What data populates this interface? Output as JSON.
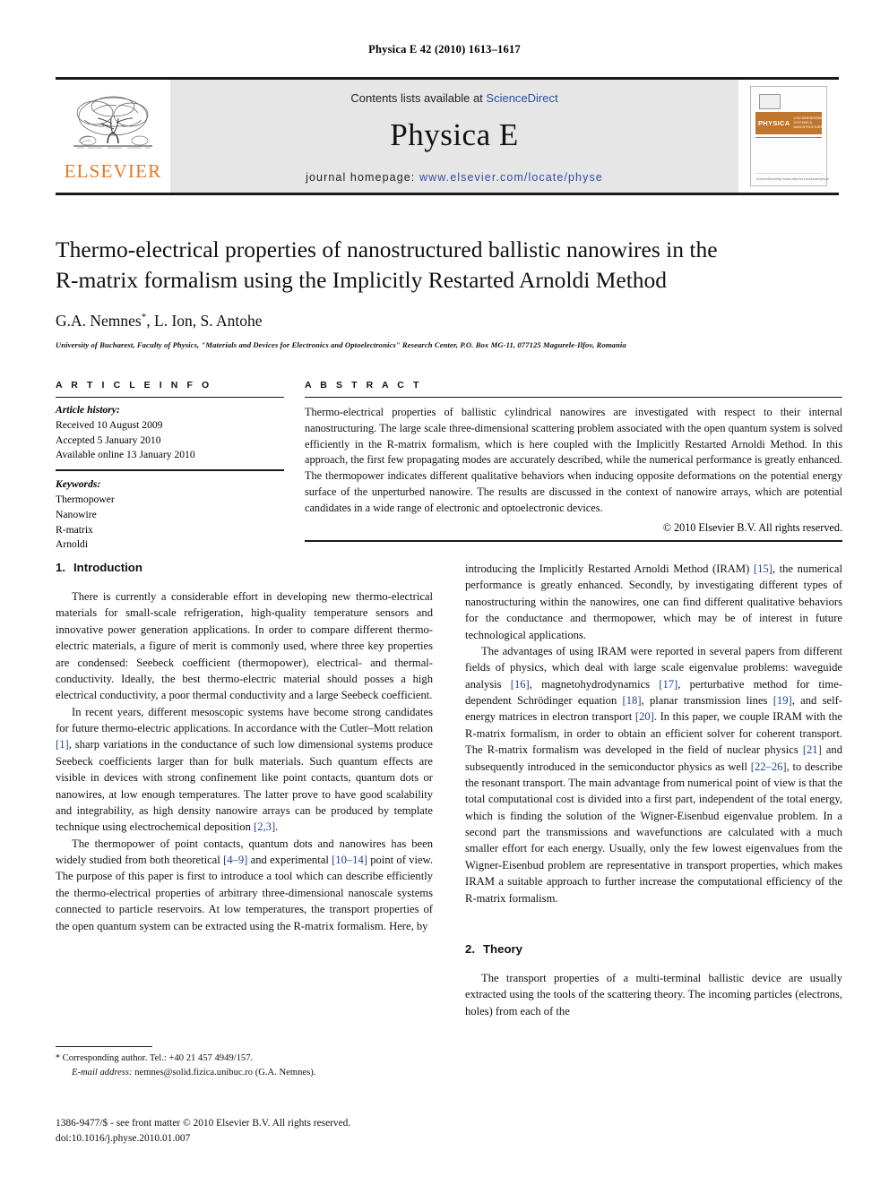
{
  "running_head": "Physica E 42 (2010) 1613–1617",
  "masthead": {
    "contents_prefix": "Contents lists available at ",
    "contents_link": "ScienceDirect",
    "journal_title": "Physica E",
    "homepage_prefix": "journal homepage: ",
    "homepage_url": "www.elsevier.com/locate/physe",
    "publisher_wordmark": "ELSEVIER",
    "publisher_logo_icon": "elsevier-tree-icon",
    "cover": {
      "band_word": "PHYSICA",
      "band_letter": "E",
      "band_subtitle": "LOW-DIMENSIONAL SYSTEMS & NANOSTRUCTURES",
      "footer_left": "Available online at",
      "footer_left_brand": "ScienceDirect",
      "footer_left_url": "www.sciencedirect.com",
      "footer_right": "http://www.elsevier.com/locate/physe"
    },
    "link_color": "#2b4fa2",
    "band_color": "#c0762c",
    "wordmark_color": "#e87722"
  },
  "title_block": {
    "title_line_1": "Thermo-electrical properties of nanostructured ballistic nanowires in the",
    "title_line_2": "R-matrix formalism using the Implicitly Restarted Arnoldi Method",
    "authors": "G.A. Nemnes",
    "authors_marker": "*",
    "authors_rest": ", L. Ion, S. Antohe",
    "affiliation": "University of Bucharest, Faculty of Physics, \"Materials and Devices for Electronics and Optoelectronics\" Research Center, P.O. Box MG-11, 077125 Magurele-Ilfov, Romania"
  },
  "article_info": {
    "heading": "A R T I C L E   I N F O",
    "history_label": "Article history:",
    "history": [
      "Received 10 August 2009",
      "Accepted 5 January 2010",
      "Available online 13 January 2010"
    ],
    "keywords_label": "Keywords:",
    "keywords": [
      "Thermopower",
      "Nanowire",
      "R-matrix",
      "Arnoldi"
    ]
  },
  "abstract": {
    "heading": "A B S T R A C T",
    "text": "Thermo-electrical properties of ballistic cylindrical nanowires are investigated with respect to their internal nanostructuring. The large scale three-dimensional scattering problem associated with the open quantum system is solved efficiently in the R-matrix formalism, which is here coupled with the Implicitly Restarted Arnoldi Method. In this approach, the first few propagating modes are accurately described, while the numerical performance is greatly enhanced. The thermopower indicates different qualitative behaviors when inducing opposite deformations on the potential energy surface of the unperturbed nanowire. The results are discussed in the context of nanowire arrays, which are potential candidates in a wide range of electronic and optoelectronic devices.",
    "copyright": "© 2010 Elsevier B.V. All rights reserved."
  },
  "sections": {
    "introduction": {
      "number": "1.",
      "title": "Introduction",
      "paragraphs_left": [
        "There is currently a considerable effort in developing new thermo-electrical materials for small-scale refrigeration, high-quality temperature sensors and innovative power generation applications. In order to compare different thermo-electric materials, a figure of merit is commonly used, where three key properties are condensed: Seebeck coefficient (thermopower), electrical- and thermal-conductivity. Ideally, the best thermo-electric material should posses a high electrical conductivity, a poor thermal conductivity and a large Seebeck coefficient.",
        "In recent years, different mesoscopic systems have become strong candidates for future thermo-electric applications. In accordance with the Cutler–Mott relation [1], sharp variations in the conductance of such low dimensional systems produce Seebeck coefficients larger than for bulk materials. Such quantum effects are visible in devices with strong confinement like point contacts, quantum dots or nanowires, at low enough temperatures. The latter prove to have good scalability and integrability, as high density nanowire arrays can be produced by template technique using electrochemical deposition [2,3].",
        "The thermopower of point contacts, quantum dots and nanowires has been widely studied from both theoretical [4–9] and experimental [10–14] point of view. The purpose of this paper is first to introduce a tool which can describe efficiently the thermo-electrical properties of arbitrary three-dimensional nanoscale systems connected to particle reservoirs. At low temperatures, the transport properties of the open quantum system can be extracted using the R-matrix formalism. Here, by"
      ],
      "paragraphs_right": [
        "introducing the Implicitly Restarted Arnoldi Method (IRAM) [15], the numerical performance is greatly enhanced. Secondly, by investigating different types of nanostructuring within the nanowires, one can find different qualitative behaviors for the conductance and thermopower, which may be of interest in future technological applications.",
        "The advantages of using IRAM were reported in several papers from different fields of physics, which deal with large scale eigenvalue problems: waveguide analysis [16], magnetohydrodynamics [17], perturbative method for time-dependent Schrödinger equation [18], planar transmission lines [19], and self-energy matrices in electron transport [20]. In this paper, we couple IRAM with the R-matrix formalism, in order to obtain an efficient solver for coherent transport. The R-matrix formalism was developed in the field of nuclear physics [21] and subsequently introduced in the semiconductor physics as well [22–26], to describe the resonant transport. The main advantage from numerical point of view is that the total computational cost is divided into a first part, independent of the total energy, which is finding the solution of the Wigner-Eisenbud eigenvalue problem. In a second part the transmissions and wavefunctions are calculated with a much smaller effort for each energy. Usually, only the few lowest eigenvalues from the Wigner-Eisenbud problem are representative in transport properties, which makes IRAM a suitable approach to further increase the computational efficiency of the R-matrix formalism."
      ]
    },
    "theory": {
      "number": "2.",
      "title": "Theory",
      "paragraph": "The transport properties of a multi-terminal ballistic device are usually extracted using the tools of the scattering theory. The incoming particles (electrons, holes) from each of the"
    }
  },
  "footnote": {
    "star": "*",
    "corresponding": "Corresponding author. Tel.: +40 21 457 4949/157.",
    "email_label": "E-mail address:",
    "email": "nemnes@solid.fizica.unibuc.ro (G.A. Nemnes)."
  },
  "footer": {
    "line1": "1386-9477/$ - see front matter © 2010 Elsevier B.V. All rights reserved.",
    "line2": "doi:10.1016/j.physe.2010.01.007"
  },
  "link_color": "#1f3f94"
}
